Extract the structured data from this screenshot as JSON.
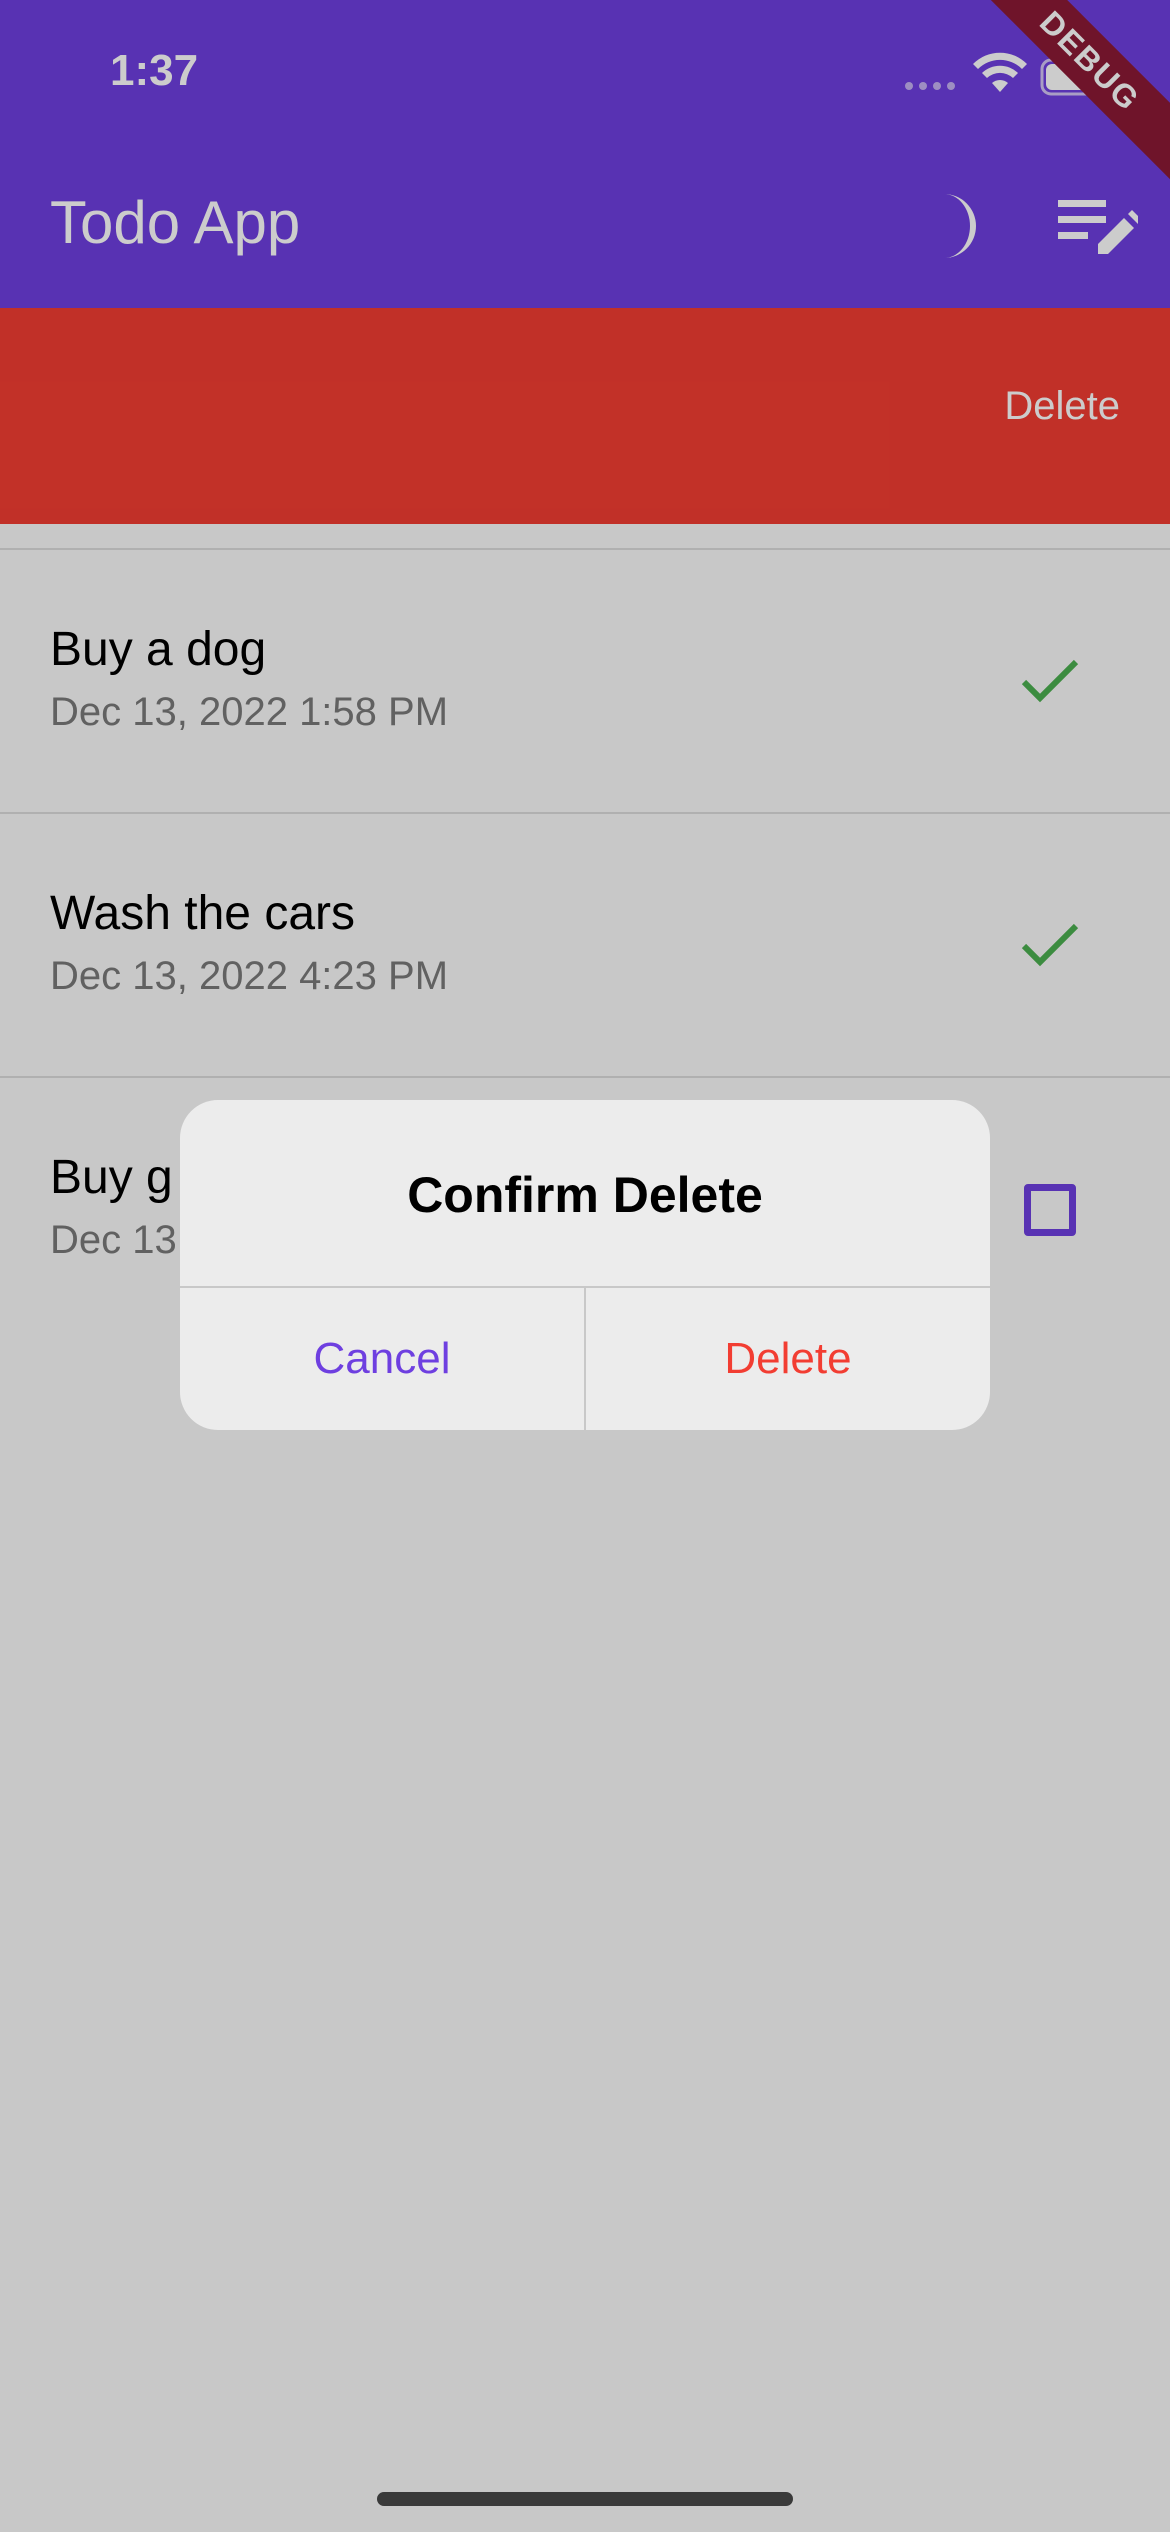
{
  "status_bar": {
    "time": "1:37",
    "icons": [
      "signal-icon",
      "wifi-icon",
      "battery-icon"
    ]
  },
  "debug_banner": "DEBUG",
  "app_bar": {
    "title": "Todo App",
    "actions": [
      "dark-mode-icon",
      "edit-list-icon"
    ]
  },
  "swipe_action": {
    "label": "Delete",
    "color": "#f23d32"
  },
  "todos": [
    {
      "title": "Buy a dog",
      "date": "Dec 13, 2022  1:58 PM",
      "completed": true
    },
    {
      "title": "Wash the cars",
      "date": "Dec 13, 2022  4:23 PM",
      "completed": true
    },
    {
      "title": "Buy g",
      "date": "Dec 13",
      "completed": false
    }
  ],
  "dialog": {
    "title": "Confirm Delete",
    "cancel_label": "Cancel",
    "confirm_label": "Delete"
  },
  "colors": {
    "primary": "#6e3fe0",
    "danger": "#f23d32",
    "success": "#4caf50"
  }
}
